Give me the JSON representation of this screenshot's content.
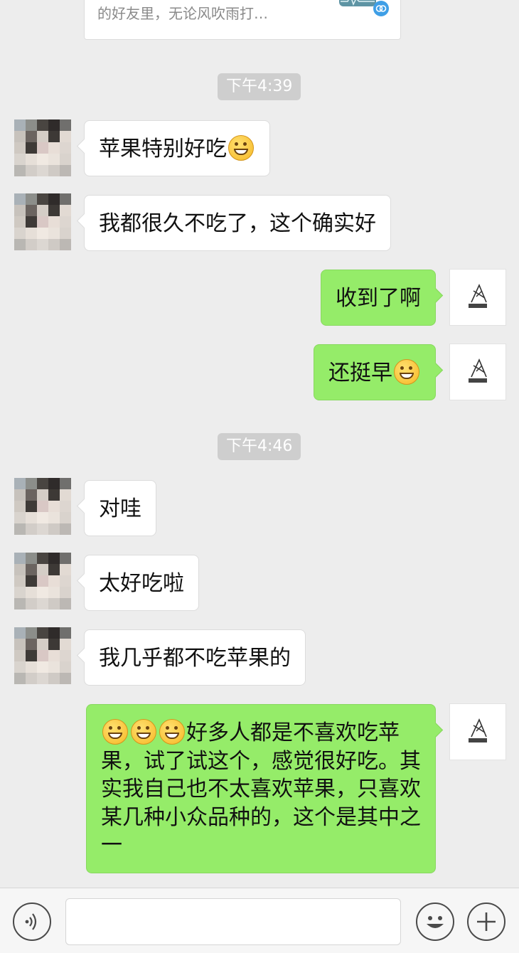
{
  "link_card": {
    "desc": "的好友里，无论风吹雨打…"
  },
  "timestamps": [
    "下午4:39",
    "下午4:46"
  ],
  "messages": [
    {
      "from": "contact",
      "text": "苹果特别好吃",
      "emoji_after": "grinning-face"
    },
    {
      "from": "contact",
      "text": "我都很久不吃了，这个确实好"
    },
    {
      "from": "me",
      "text": "收到了啊"
    },
    {
      "from": "me",
      "text": "还挺早",
      "emoji_after": "grinning-face"
    },
    {
      "from": "contact",
      "text": "对哇"
    },
    {
      "from": "contact",
      "text": "太好吃啦"
    },
    {
      "from": "contact",
      "text": "我几乎都不吃苹果的"
    },
    {
      "from": "me",
      "emoji_before": [
        "grinning-face",
        "grinning-face",
        "grinning-face"
      ],
      "text": "好多人都是不喜欢吃苹果，试了试这个，感觉很好吃。其实我自己也不太喜欢苹果，只喜欢某几种小众品种的，这个是其中之一"
    }
  ],
  "colors": {
    "background": "#ededed",
    "outgoing_bubble": "#95ec69",
    "incoming_bubble": "#ffffff",
    "timestamp_bg": "#cecece"
  },
  "input_bar": {
    "voice_icon": "voice-icon",
    "emoji_icon": "emoji-icon",
    "plus_icon": "plus-icon"
  }
}
